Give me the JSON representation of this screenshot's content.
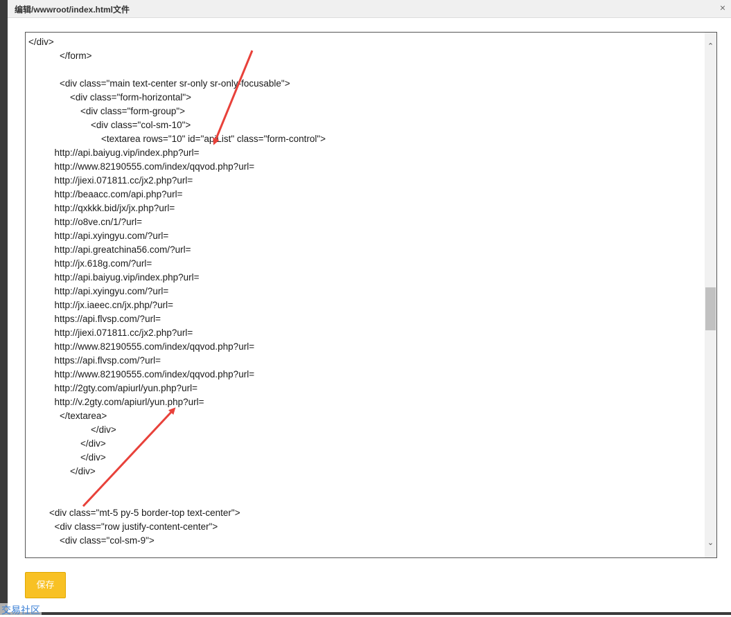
{
  "dialog": {
    "title": "编辑/wwwroot/index.html文件",
    "close_label": "×"
  },
  "editor": {
    "lines": [
      "</div>",
      "            </form>",
      "",
      "            <div class=\"main text-center sr-only sr-only-focusable\">",
      "                <div class=\"form-horizontal\">",
      "                    <div class=\"form-group\">",
      "                        <div class=\"col-sm-10\">",
      "                            <textarea rows=\"10\" id=\"apiList\" class=\"form-control\">",
      "          http://api.baiyug.vip/index.php?url=",
      "          http://www.82190555.com/index/qqvod.php?url=",
      "          http://jiexi.071811.cc/jx2.php?url=",
      "          http://beaacc.com/api.php?url=",
      "          http://qxkkk.bid/jx/jx.php?url=",
      "          http://o8ve.cn/1/?url=",
      "          http://api.xyingyu.com/?url=",
      "          http://api.greatchina56.com/?url=",
      "          http://jx.618g.com/?url=",
      "          http://api.baiyug.vip/index.php?url=",
      "          http://api.xyingyu.com/?url=",
      "          http://jx.iaeec.cn/jx.php/?url=",
      "          https://api.flvsp.com/?url=",
      "          http://jiexi.071811.cc/jx2.php?url=",
      "          http://www.82190555.com/index/qqvod.php?url=",
      "          https://api.flvsp.com/?url=",
      "          http://www.82190555.com/index/qqvod.php?url=",
      "          http://2gty.com/apiurl/yun.php?url=",
      "          http://v.2gty.com/apiurl/yun.php?url=",
      "            </textarea>",
      "                        </div>",
      "                    </div>",
      "                    </div>",
      "                </div>",
      "",
      "",
      "        <div class=\"mt-5 py-5 border-top text-center\">",
      "          <div class=\"row justify-content-center\">",
      "            <div class=\"col-sm-9\">"
    ]
  },
  "scrollbar": {
    "up_icon": "chevron-up-icon",
    "down_icon": "chevron-down-icon",
    "up_glyph": "⌃",
    "down_glyph": "⌄"
  },
  "footer": {
    "save_label": "保存"
  },
  "watermark": {
    "text": "交易社区"
  },
  "colors": {
    "save_button": "#f8c124",
    "arrow": "#e8413a",
    "title_bar": "#f0f0f0"
  }
}
